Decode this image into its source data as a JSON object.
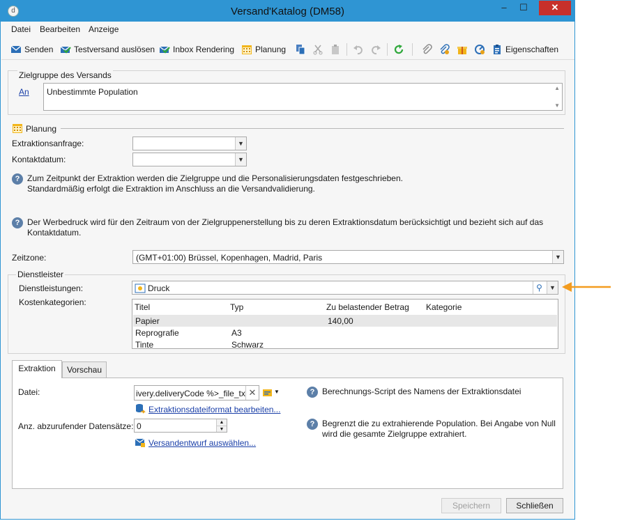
{
  "window": {
    "title": "Versand'Katalog (DM58)",
    "app_icon_glyph": "d",
    "minimize_glyph": "–",
    "maximize_glyph": "☐",
    "close_glyph": "✕"
  },
  "menu": [
    "Datei",
    "Bearbeiten",
    "Anzeige"
  ],
  "toolbar": {
    "send_label": "Senden",
    "proof_label": "Testversand auslösen",
    "inbox_label": "Inbox Rendering",
    "planning_label": "Planung",
    "properties_label": "Eigenschaften"
  },
  "target": {
    "group_title": "Zielgruppe des Versands",
    "to_link": "An",
    "population": "Unbestimmte Population"
  },
  "planning": {
    "group_title": "Planung",
    "extraction_request_label": "Extraktionsanfrage:",
    "extraction_request_value": "",
    "contact_date_label": "Kontaktdatum:",
    "contact_date_value": "",
    "help1_line1": "Zum Zeitpunkt der Extraktion werden die Zielgruppe und die Personalisierungsdaten festgeschrieben.",
    "help1_line2": "Standardmäßig erfolgt die Extraktion im Anschluss an die Versandvalidierung.",
    "help2_line1": "Der Werbedruck wird für den Zeitraum von der Zielgruppenerstellung bis zu deren Extraktionsdatum berücksichtigt und bezieht sich auf das",
    "help2_line2": "Kontaktdatum.",
    "timezone_label": "Zeitzone:",
    "timezone_value": "(GMT+01:00) Brüssel, Kopenhagen, Madrid, Paris"
  },
  "provider": {
    "group_title": "Dienstleister",
    "services_label": "Dienstleistungen:",
    "services_value": "Druck",
    "cost_categories_label": "Kostenkategorien:",
    "columns": [
      "Titel",
      "Typ",
      "Zu belastender Betrag",
      "Kategorie"
    ],
    "rows": [
      {
        "title": "Papier",
        "type": "",
        "amount": "140,00",
        "category": ""
      },
      {
        "title": "Reprografie",
        "type": "A3",
        "amount": "",
        "category": ""
      },
      {
        "title": "Tinte",
        "type": "Schwarz",
        "amount": "",
        "category": ""
      }
    ]
  },
  "tabs": [
    "Extraktion",
    "Vorschau"
  ],
  "extraction": {
    "file_label": "Datei:",
    "file_value": "ivery.deliveryCode %>_file_txt",
    "edit_format_link": "Extraktionsdateiformat bearbeiten...",
    "count_label": "Anz. abzurufender Datensätze:",
    "count_value": "0",
    "select_template_link": "Versandentwurf auswählen...",
    "help_file": "Berechnungs-Script des Namens der Extraktionsdatei",
    "help_count_line1": "Begrenzt die zu extrahierende Population. Bei Angabe von Null",
    "help_count_line2": "wird die gesamte Zielgruppe extrahiert."
  },
  "buttons": {
    "save_label": "Speichern",
    "close_label": "Schließen"
  },
  "colors": {
    "titlebar": "#2f95d3",
    "close_button": "#c7302b",
    "annotation_arrow": "#f39c1f",
    "link": "#1a3fa8"
  }
}
